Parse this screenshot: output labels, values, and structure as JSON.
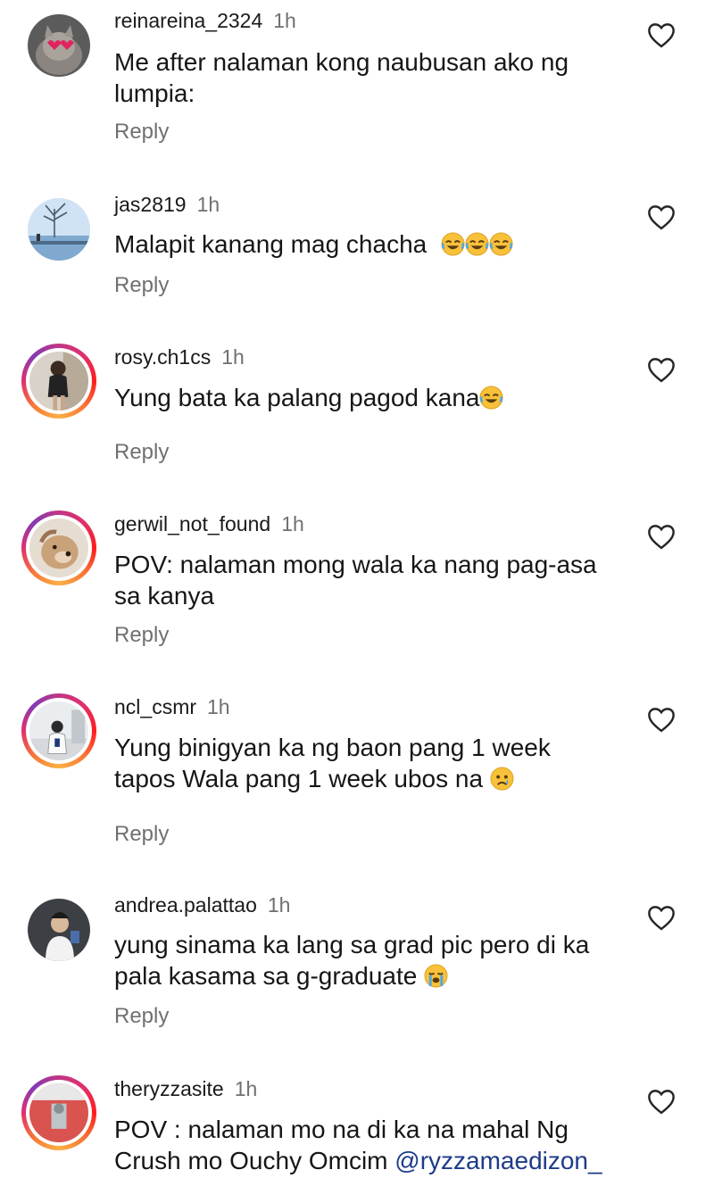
{
  "comments": [
    {
      "username": "reinareina_2324",
      "time": "1h",
      "text_lines": [
        "Me after nalaman kong naubusan ako ng",
        "lumpia:"
      ],
      "reply": "Reply",
      "emoji": []
    },
    {
      "username": "jas2819",
      "time": "1h",
      "text": "Malapit kanang mag chacha",
      "emoji": [
        "😂",
        "😂",
        "😂"
      ],
      "reply": "Reply"
    },
    {
      "username": "rosy.ch1cs",
      "time": "1h",
      "text": "Yung bata ka palang pagod kana",
      "emoji": [
        "😂"
      ],
      "reply": "Reply"
    },
    {
      "username": "gerwil_not_found",
      "time": "1h",
      "text_lines": [
        "POV: nalaman mong wala ka nang pag-asa",
        "sa kanya"
      ],
      "reply": "Reply",
      "emoji": []
    },
    {
      "username": "ncl_csmr",
      "time": "1h",
      "text_lines": [
        "Yung binigyan ka ng baon pang 1 week",
        "tapos Wala pang 1 week ubos na"
      ],
      "emoji": [
        "😢"
      ],
      "reply": "Reply"
    },
    {
      "username": "andrea.palattao",
      "time": "1h",
      "text_lines": [
        "yung sinama ka lang sa grad pic pero di ka",
        "pala kasama sa g-graduate"
      ],
      "emoji": [
        "😭"
      ],
      "reply": "Reply"
    },
    {
      "username": "theryzzasite",
      "time": "1h",
      "text_lines": [
        "POV : nalaman mo na di ka na mahal Ng",
        "Crush mo Ouchy Omcim"
      ],
      "mention": "@ryzzamaedizon_",
      "reply": "Reply"
    }
  ],
  "colors": {
    "heart_outline": "#262626",
    "muted": "#707070",
    "story_ring": "#e1306c",
    "mention": "#1e3a8a"
  },
  "icons": {
    "like": "heart-outline-icon",
    "laugh": "face-with-tears-of-joy",
    "sad": "crying-face",
    "sob": "loudly-crying-face"
  }
}
